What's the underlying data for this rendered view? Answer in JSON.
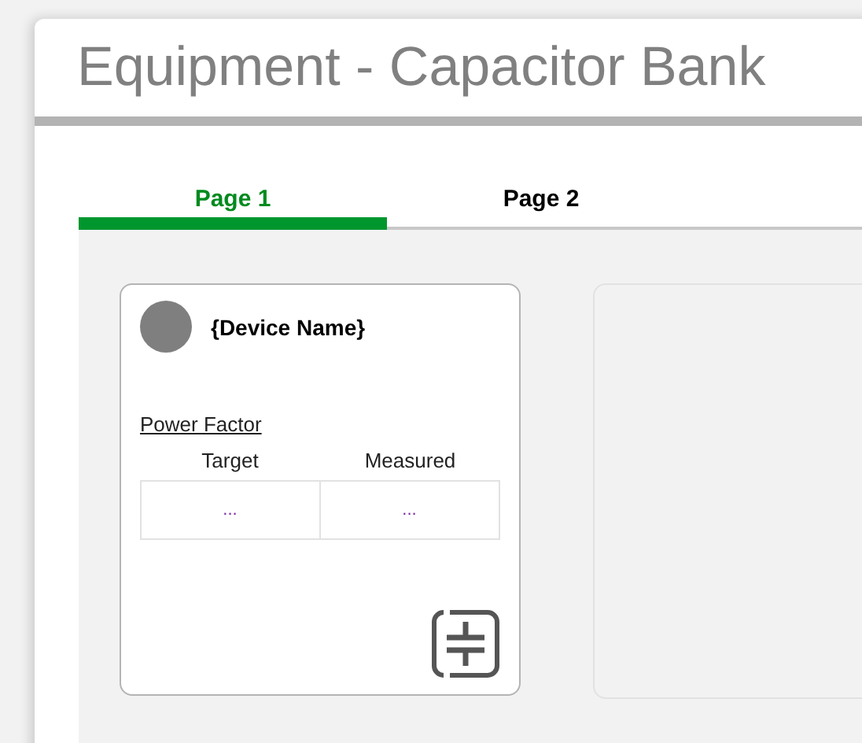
{
  "window": {
    "title": "Equipment - Capacitor Bank"
  },
  "tabs": [
    {
      "label": "Page 1",
      "selected": true
    },
    {
      "label": "Page 2",
      "selected": false
    }
  ],
  "device_card": {
    "name": "{Device Name}",
    "color": "#7f7f7f",
    "section_link": "Power Factor",
    "columns": [
      "Target",
      "Measured"
    ],
    "values": [
      "...",
      "..."
    ]
  }
}
